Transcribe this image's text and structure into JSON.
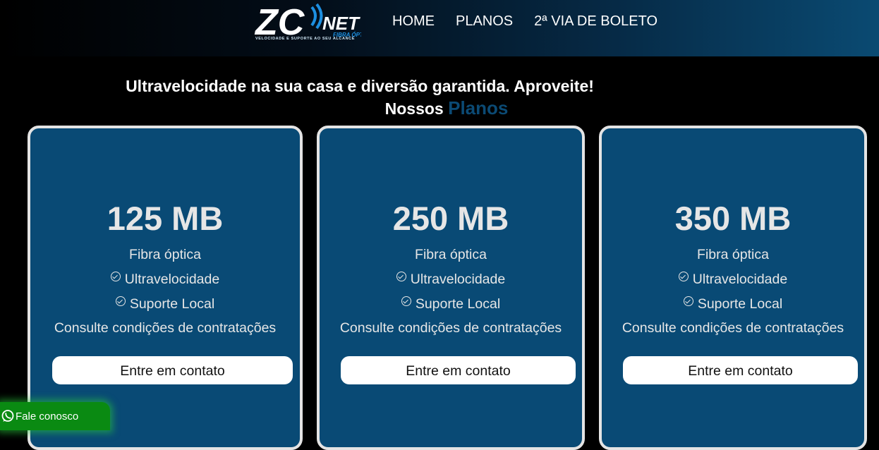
{
  "header": {
    "logo_text": "ZCNET",
    "logo_subtitle": "FIBRA ÓPTICA",
    "logo_tagline": "VELOCIDADE E SUPORTE AO SEU ALCANCE",
    "nav": [
      "HOME",
      "PLANOS",
      "2ª VIA DE BOLETO"
    ]
  },
  "hero": {
    "headline": "Ultravelocidade na sua casa e diversão garantida. Aproveite!",
    "sub_prefix": "Nossos",
    "sub_accent": "Planos"
  },
  "plans": [
    {
      "speed": "125 MB",
      "fiber": "Fibra óptica",
      "feature1": "Ultravelocidade",
      "feature2": "Suporte Local",
      "conditions": "Consulte condições de contratações",
      "cta": "Entre em contato"
    },
    {
      "speed": "250 MB",
      "fiber": "Fibra óptica",
      "feature1": "Ultravelocidade",
      "feature2": "Suporte Local",
      "conditions": "Consulte condições de contratações",
      "cta": "Entre em contato"
    },
    {
      "speed": "350 MB",
      "fiber": "Fibra óptica",
      "feature1": "Ultravelocidade",
      "feature2": "Suporte Local",
      "conditions": "Consulte condições de contratações",
      "cta": "Entre em contato"
    }
  ],
  "whatsapp": {
    "label": "Fale conosco",
    "icon": "whatsapp-icon"
  },
  "colors": {
    "card_bg": "#094a75",
    "accent": "#0b4a74",
    "whatsapp": "#0a8a12"
  }
}
